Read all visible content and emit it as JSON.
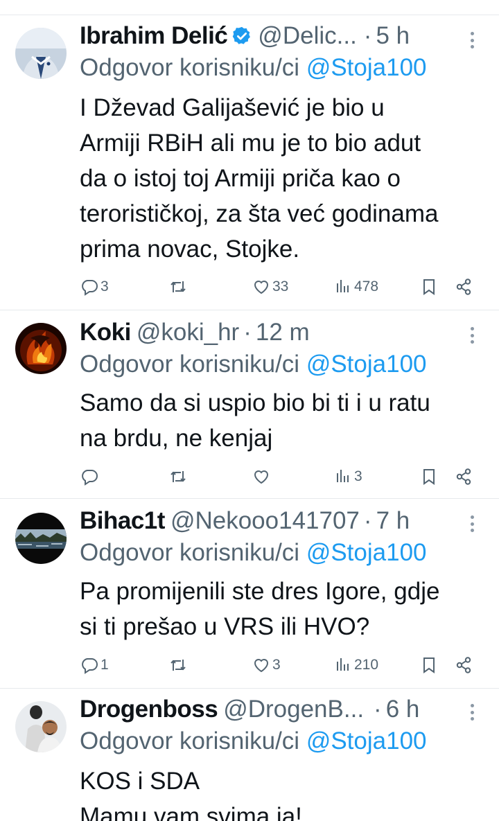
{
  "reply_prefix": "Odgovor korisniku/ci",
  "tweets": [
    {
      "name": "Ibrahim Delić",
      "verified": true,
      "handle": "@Delic...",
      "time": "5 h",
      "reply_mention": "@Stoja100",
      "text_lines": [
        "I Dževad Galijašević je bio u",
        "Armiji RBiH ali mu je to bio adut",
        "da o istoj toj Armiji priča kao o",
        "terorističkoj, za šta već godinama",
        "prima novac, Stojke."
      ],
      "replies": "3",
      "retweets": "",
      "likes": "33",
      "views": "478"
    },
    {
      "name": "Koki",
      "verified": false,
      "handle": "@koki_hr",
      "time": "12 m",
      "reply_mention": "@Stoja100",
      "text_lines": [
        "Samo da si uspio bio bi ti i u ratu",
        "na brdu, ne kenjaj"
      ],
      "replies": "",
      "retweets": "",
      "likes": "",
      "views": "3"
    },
    {
      "name": "Bihac1t",
      "verified": false,
      "handle": "@Nekooo141707",
      "time": "7 h",
      "reply_mention": "@Stoja100",
      "text_lines": [
        "Pa promijenili ste dres Igore, gdje",
        "si ti prešao u VRS ili HVO?"
      ],
      "replies": "1",
      "retweets": "",
      "likes": "3",
      "views": "210"
    },
    {
      "name": "Drogenboss",
      "verified": false,
      "handle": "@DrogenB...",
      "time": "6 h",
      "reply_mention": "@Stoja100",
      "text_lines": [
        "KOS i SDA",
        "Mamu vam svima ja!"
      ]
    }
  ],
  "icons": {
    "reply": "speech-bubble-icon",
    "retweet": "retweet-icon",
    "like": "heart-icon",
    "views": "bar-chart-icon",
    "bookmark": "bookmark-icon",
    "share": "share-icon",
    "more": "more-vertical-icon",
    "verified": "verified-badge-icon"
  },
  "colors": {
    "accent": "#1d9bf0",
    "text": "#0f1419",
    "muted": "#536471",
    "divider": "#e6e9ec"
  }
}
